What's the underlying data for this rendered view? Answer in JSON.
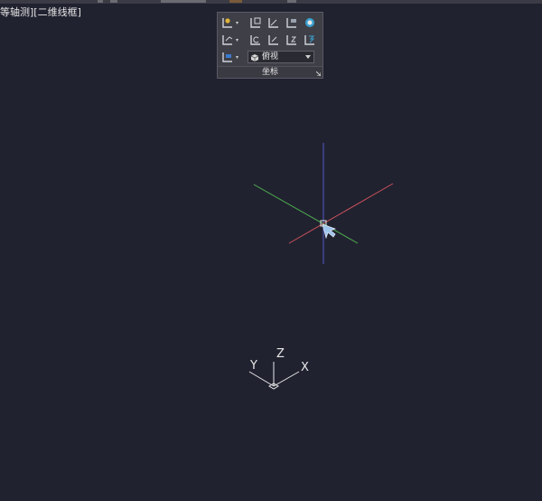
{
  "viewport": {
    "label": "等轴测][二维线框]"
  },
  "coordinates_panel": {
    "title": "坐标",
    "view_dropdown": {
      "selected": "俯视"
    },
    "tools": [
      {
        "name": "ucs-world-icon"
      },
      {
        "name": "ucs-named-icon"
      },
      {
        "name": "ucs-origin-icon"
      },
      {
        "name": "ucs-face-icon"
      },
      {
        "name": "ucs-object-icon"
      },
      {
        "name": "ucs-3point-icon"
      },
      {
        "name": "ucs-previous-icon"
      },
      {
        "name": "ucs-x-rotate-icon"
      },
      {
        "name": "ucs-z-rotate-icon"
      },
      {
        "name": "ucs-y-rotate-icon"
      },
      {
        "name": "ucs-view-icon"
      }
    ]
  },
  "ucs_icon": {
    "x_label": "X",
    "y_label": "Y",
    "z_label": "Z"
  },
  "colors": {
    "background": "#212230",
    "axis_x": "#c8515a",
    "axis_y": "#4fb34f",
    "axis_z": "#5558c8",
    "ucs_icon": "#e8e8e8"
  }
}
